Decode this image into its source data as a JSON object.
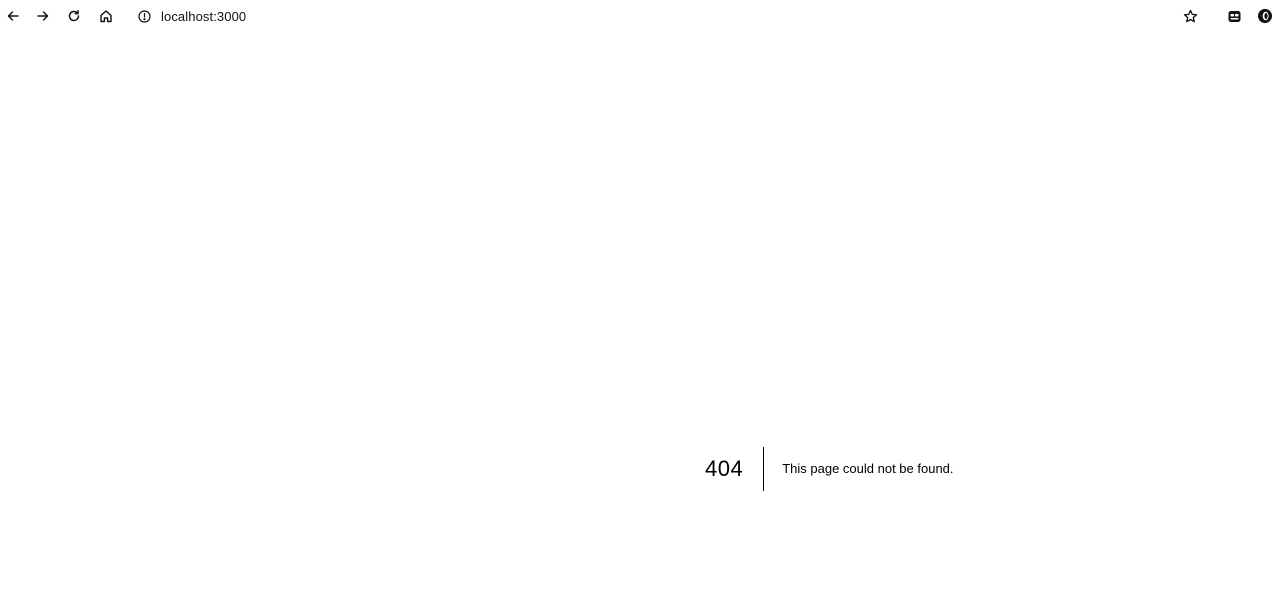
{
  "browser": {
    "url": "localhost:3000",
    "icons": {
      "back": "arrow-left-icon",
      "forward": "arrow-right-icon",
      "reload": "reload-icon",
      "home": "home-icon",
      "site_info": "info-icon",
      "bookmark": "star-icon",
      "extension": "extension-icon",
      "profile": "profile-icon"
    }
  },
  "error_page": {
    "code": "404",
    "message": "This page could not be found."
  }
}
